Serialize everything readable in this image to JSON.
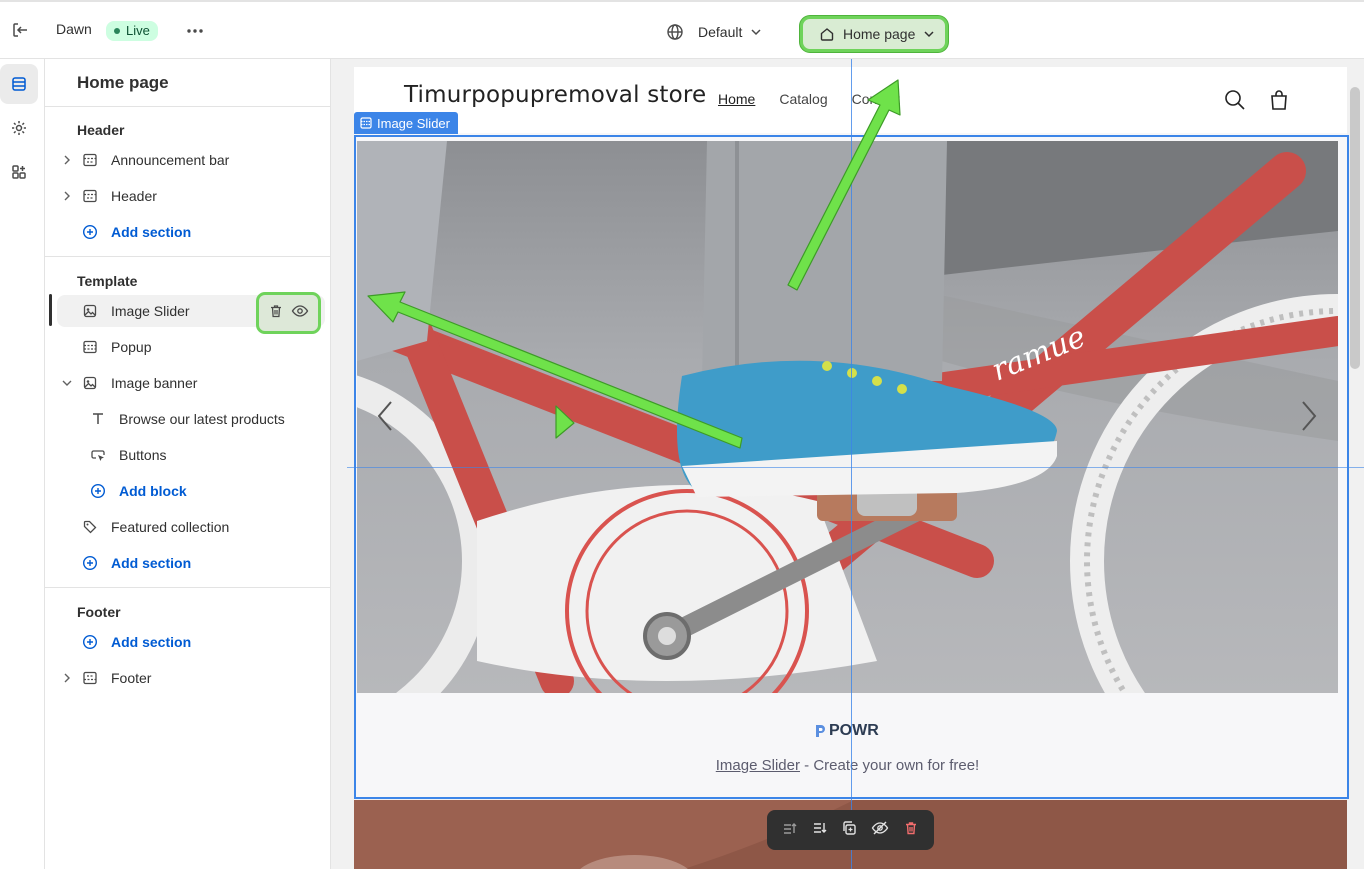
{
  "topbar": {
    "theme_name": "Dawn",
    "live_label": "Live",
    "locale_label": "Default",
    "page_label": "Home page"
  },
  "sidebar": {
    "title": "Home page",
    "groups": {
      "header": {
        "title": "Header",
        "items": [
          "Announcement bar",
          "Header"
        ],
        "add_label": "Add section"
      },
      "template": {
        "title": "Template",
        "items": [
          "Image Slider",
          "Popup",
          "Image banner",
          "Featured collection"
        ],
        "blocks": [
          "Browse our latest products",
          "Buttons"
        ],
        "add_block_label": "Add block",
        "add_label": "Add section"
      },
      "footer": {
        "title": "Footer",
        "add_label": "Add section",
        "items": [
          "Footer"
        ]
      }
    }
  },
  "preview": {
    "store_name": "Timurpopupremoval store",
    "nav": [
      "Home",
      "Catalog",
      "Contact"
    ],
    "section_tag": "Image Slider",
    "powr_logo": "POWR",
    "caption_link": "Image Slider",
    "caption_rest": " - Create your own for free!"
  },
  "colors": {
    "accent": "#3c85e8",
    "highlight": "#6fd35b",
    "link": "#005bd3",
    "live_bg": "#cdfee1"
  }
}
